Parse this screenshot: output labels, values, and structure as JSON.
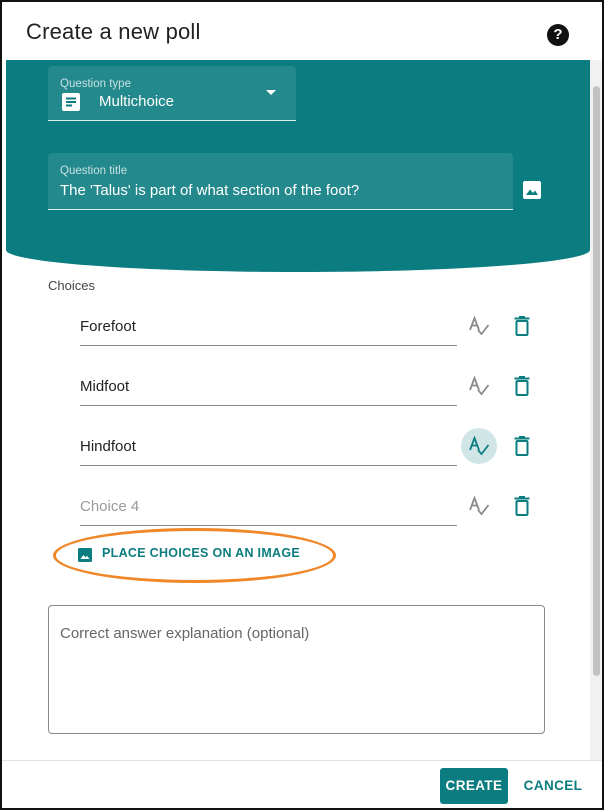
{
  "dialog": {
    "title": "Create a new poll",
    "help_icon": "help-circle-icon"
  },
  "question_type": {
    "label": "Question type",
    "value": "Multichoice",
    "icon": "list-form-icon"
  },
  "question_title": {
    "label": "Question title",
    "value": "The 'Talus' is part of what section of the foot?",
    "image_icon": "image-icon"
  },
  "choices": {
    "label": "Choices",
    "items": [
      {
        "value": "Forefoot",
        "placeholder": "",
        "correct": false
      },
      {
        "value": "Midfoot",
        "placeholder": "",
        "correct": false
      },
      {
        "value": "Hindfoot",
        "placeholder": "",
        "correct": true
      },
      {
        "value": "",
        "placeholder": "Choice 4",
        "correct": false
      }
    ],
    "correct_icon": "spellcheck-icon",
    "delete_icon": "trash-icon"
  },
  "place_on_image": {
    "label": "PLACE CHOICES ON AN IMAGE",
    "icon": "image-icon"
  },
  "explanation": {
    "placeholder": "Correct answer explanation (optional)"
  },
  "footer": {
    "create_label": "CREATE",
    "cancel_label": "CANCEL"
  },
  "colors": {
    "accent": "#0b7c7f",
    "highlight": "#f0882a",
    "selected_bg": "#cfe5e6"
  }
}
